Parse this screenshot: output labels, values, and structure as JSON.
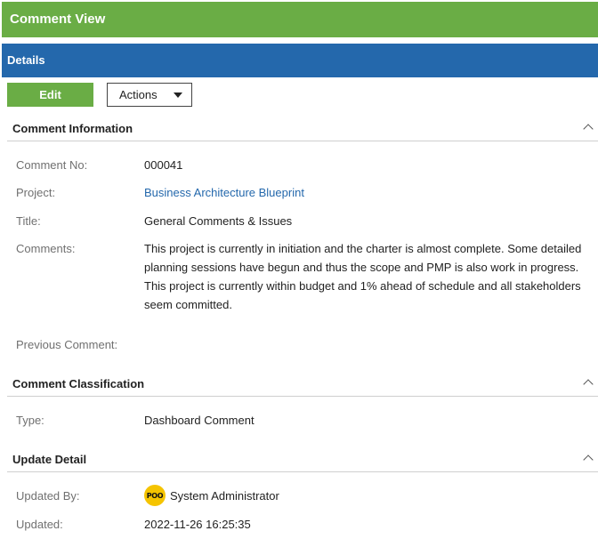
{
  "window": {
    "title": "Comment View"
  },
  "panel": {
    "title": "Details"
  },
  "toolbar": {
    "edit_label": "Edit",
    "actions_label": "Actions"
  },
  "sections": {
    "comment_info": {
      "title": "Comment Information",
      "fields": {
        "comment_no": {
          "label": "Comment No:",
          "value": "000041"
        },
        "project": {
          "label": "Project:",
          "value": "Business Architecture Blueprint"
        },
        "title": {
          "label": "Title:",
          "value": "General Comments & Issues"
        },
        "comments": {
          "label": "Comments:",
          "value": "This project is currently in initiation and the charter is almost complete. Some detailed planning sessions have begun and thus the scope and PMP is also work in progress. This project is currently within budget and 1% ahead of schedule and all stakeholders seem committed."
        },
        "previous_comment": {
          "label": "Previous Comment:",
          "value": ""
        }
      }
    },
    "classification": {
      "title": "Comment Classification",
      "fields": {
        "type": {
          "label": "Type:",
          "value": "Dashboard Comment"
        }
      }
    },
    "update_detail": {
      "title": "Update Detail",
      "fields": {
        "updated_by": {
          "label": "Updated By:",
          "value": "System Administrator",
          "avatar_text": "POO"
        },
        "updated": {
          "label": "Updated:",
          "value": "2022-11-26 16:25:35"
        }
      }
    }
  },
  "colors": {
    "header_green": "#6aad45",
    "details_blue": "#2468ac",
    "link_blue": "#2468ac",
    "avatar_yellow": "#f5c400"
  },
  "icons": {
    "collapse": "chevron-up-icon",
    "dropdown": "caret-down-icon"
  }
}
